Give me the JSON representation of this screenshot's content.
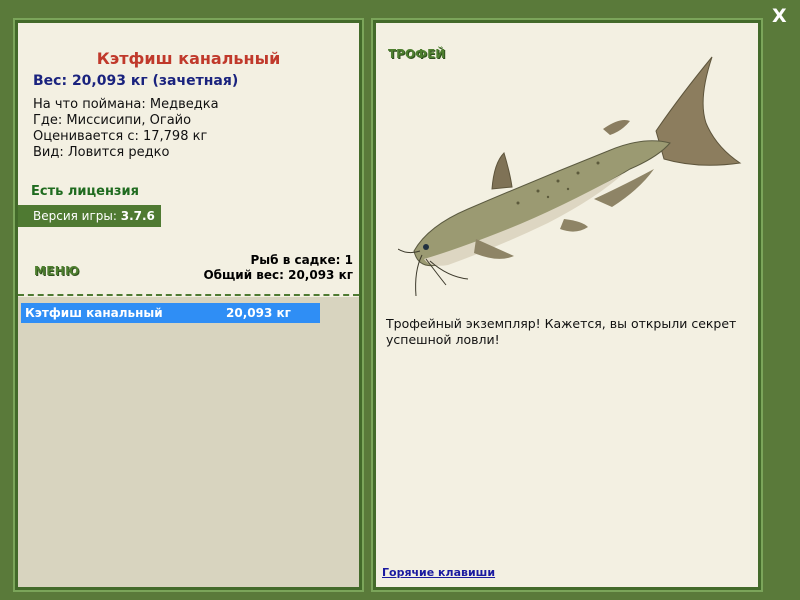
{
  "close_label": "X",
  "fish": {
    "name": "Кэтфиш канальный",
    "weight_line": "Вес: 20,093 кг (зачетная)",
    "info": [
      "На что поймана: Медведка",
      "Где: Миссисипи, Огайо",
      "Оценивается с: 17,798 кг",
      "Вид: Ловится редко"
    ]
  },
  "license": "Есть лицензия",
  "version": {
    "label": "Версия игры: ",
    "number": "3.7.6"
  },
  "menu_label": "МЕНЮ",
  "cage": {
    "count_line": "Рыб в садке: 1",
    "total_line": "Общий вес: 20,093 кг"
  },
  "catch_list": [
    {
      "name": "Кэтфиш канальный",
      "weight": "20,093 кг"
    }
  ],
  "trophy": {
    "title": "ТРОФЕЙ",
    "description": "Трофейный экземпляр! Кажется, вы открыли секрет успешной ловли!"
  },
  "hotkeys_label": "Горячие клавиши",
  "colors": {
    "background": "#5a7a3a",
    "panel": "#f3f0e2",
    "list_selected": "#2f8ef5",
    "fish_name": "#c0392b"
  }
}
